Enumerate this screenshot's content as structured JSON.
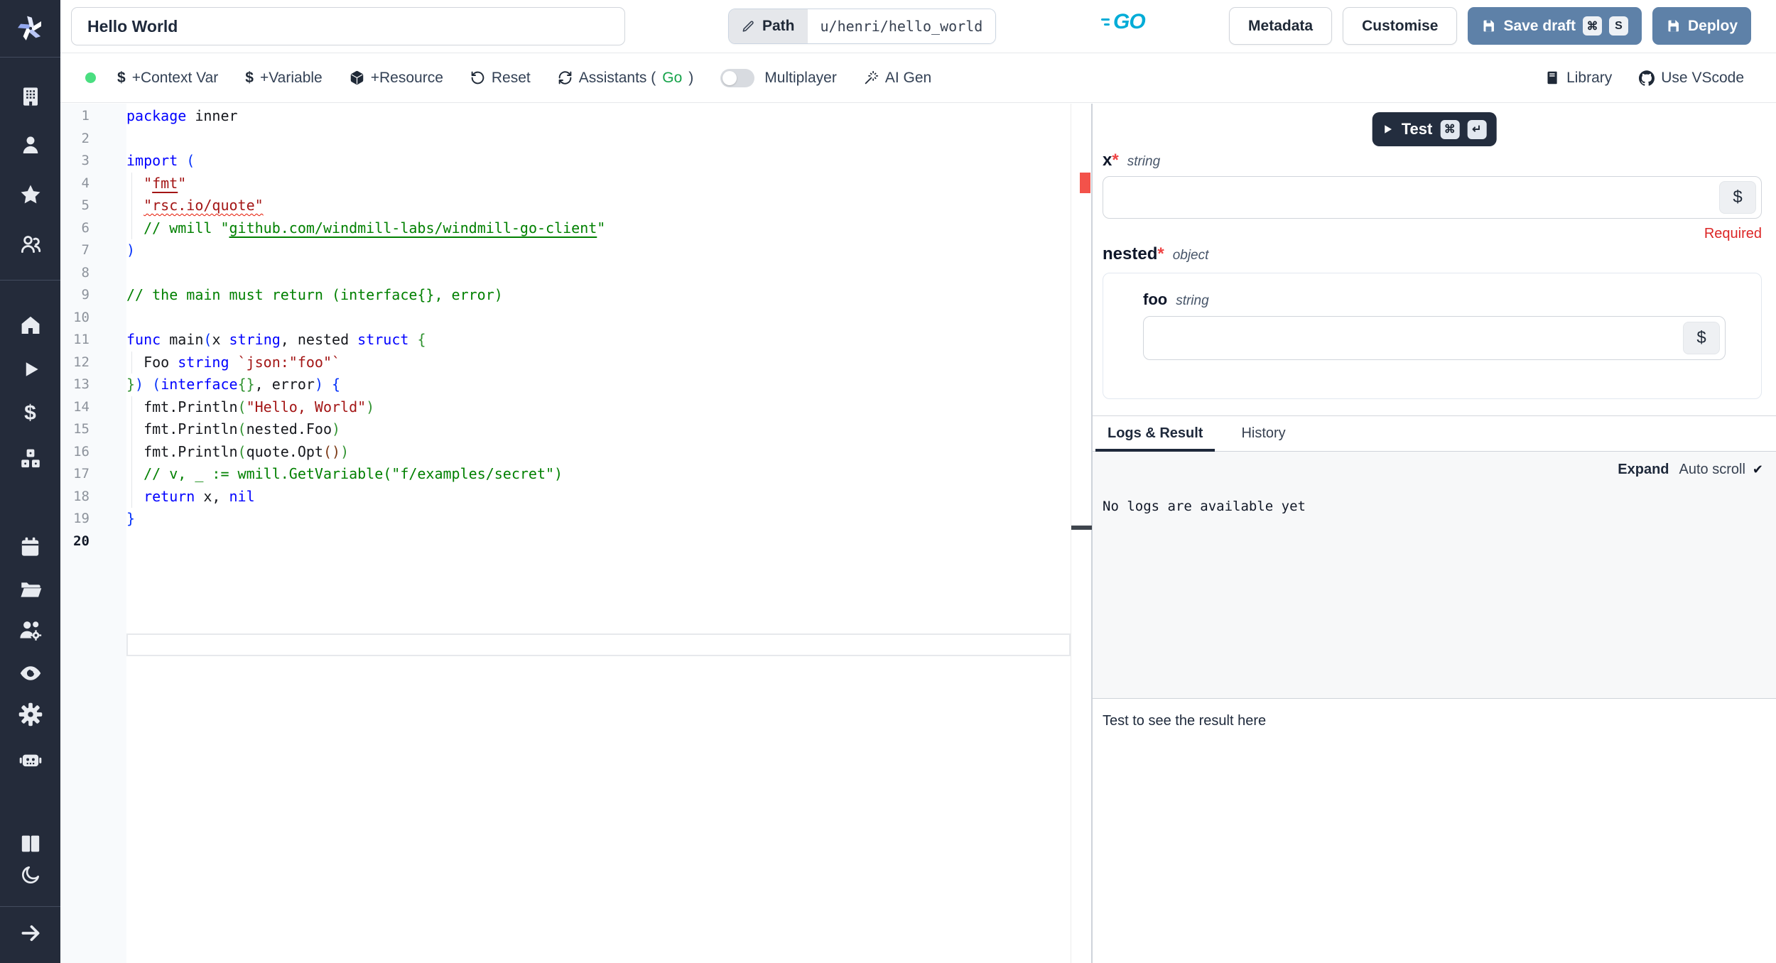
{
  "sidebar": {
    "icons": [
      "windmill-logo",
      "workspace-building",
      "user",
      "favorites-star",
      "groups",
      "home",
      "runs-play",
      "variables-dollar",
      "resources-cubes",
      "schedules-calendar",
      "folders",
      "workers-admin",
      "audit-eye",
      "settings-gear",
      "ai-robot",
      "docs-books",
      "dark-mode-moon",
      "expand-arrow"
    ]
  },
  "topbar": {
    "title": "Hello World",
    "path_label": "Path",
    "path_value": "u/henri/hello_world",
    "lang": "GO",
    "metadata": "Metadata",
    "customise": "Customise",
    "save_draft": "Save draft",
    "save_keys": [
      "⌘",
      "S"
    ],
    "deploy": "Deploy"
  },
  "toolbar": {
    "dollar": "$",
    "context_var": "+Context Var",
    "variable": "+Variable",
    "resource": "+Resource",
    "reset": "Reset",
    "assistants_pre": "Assistants (",
    "assistants_lang": "Go",
    "assistants_post": ")",
    "multiplayer": "Multiplayer",
    "ai_gen": "AI Gen",
    "library": "Library",
    "use_vscode": "Use VScode"
  },
  "editor": {
    "language": "go",
    "active_line": 20,
    "lines": [
      {
        "n": 1,
        "segs": [
          [
            "kw",
            "package"
          ],
          [
            "id",
            " inner"
          ]
        ]
      },
      {
        "n": 2,
        "segs": []
      },
      {
        "n": 3,
        "segs": [
          [
            "kw",
            "import"
          ],
          [
            "id",
            " "
          ],
          [
            "b1",
            "("
          ]
        ]
      },
      {
        "n": 4,
        "segs": [
          [
            "id",
            "  "
          ],
          [
            "str",
            "\""
          ],
          [
            "strlink",
            "fmt"
          ],
          [
            "str",
            "\""
          ]
        ]
      },
      {
        "n": 5,
        "segs": [
          [
            "id",
            "  "
          ],
          [
            "strerr",
            "\"rsc.io/quote\""
          ]
        ]
      },
      {
        "n": 6,
        "segs": [
          [
            "id",
            "  "
          ],
          [
            "com",
            "// wmill \""
          ],
          [
            "comlink",
            "github.com/windmill-labs/windmill-go-client"
          ],
          [
            "com",
            "\""
          ]
        ]
      },
      {
        "n": 7,
        "segs": [
          [
            "b1",
            ")"
          ]
        ]
      },
      {
        "n": 8,
        "segs": []
      },
      {
        "n": 9,
        "segs": [
          [
            "com",
            "// the main must return (interface{}, error)"
          ]
        ]
      },
      {
        "n": 10,
        "segs": []
      },
      {
        "n": 11,
        "segs": [
          [
            "kw",
            "func"
          ],
          [
            "id",
            " main"
          ],
          [
            "b1",
            "("
          ],
          [
            "id",
            "x "
          ],
          [
            "kw",
            "string"
          ],
          [
            "id",
            ", nested "
          ],
          [
            "kw",
            "struct"
          ],
          [
            "id",
            " "
          ],
          [
            "b2",
            "{"
          ]
        ]
      },
      {
        "n": 12,
        "segs": [
          [
            "id",
            "  Foo "
          ],
          [
            "kw",
            "string"
          ],
          [
            "id",
            " "
          ],
          [
            "str",
            "`json:\"foo\"`"
          ]
        ]
      },
      {
        "n": 13,
        "segs": [
          [
            "b2",
            "}"
          ],
          [
            "b1",
            ")"
          ],
          [
            "id",
            " "
          ],
          [
            "b1",
            "("
          ],
          [
            "kw",
            "interface"
          ],
          [
            "b2",
            "{}"
          ],
          [
            "id",
            ", error"
          ],
          [
            "b1",
            ")"
          ],
          [
            "id",
            " "
          ],
          [
            "b1",
            "{"
          ]
        ]
      },
      {
        "n": 14,
        "segs": [
          [
            "id",
            "  fmt.Println"
          ],
          [
            "b2",
            "("
          ],
          [
            "str",
            "\"Hello, World\""
          ],
          [
            "b2",
            ")"
          ]
        ]
      },
      {
        "n": 15,
        "segs": [
          [
            "id",
            "  fmt.Println"
          ],
          [
            "b2",
            "("
          ],
          [
            "id",
            "nested.Foo"
          ],
          [
            "b2",
            ")"
          ]
        ]
      },
      {
        "n": 16,
        "segs": [
          [
            "id",
            "  fmt.Println"
          ],
          [
            "b2",
            "("
          ],
          [
            "id",
            "quote.Opt"
          ],
          [
            "b3",
            "()"
          ],
          [
            "b2",
            ")"
          ]
        ]
      },
      {
        "n": 17,
        "segs": [
          [
            "com",
            "  // v, _ := wmill.GetVariable(\"f/examples/secret\")"
          ]
        ]
      },
      {
        "n": 18,
        "segs": [
          [
            "id",
            "  "
          ],
          [
            "kw",
            "return"
          ],
          [
            "id",
            " x, "
          ],
          [
            "kw",
            "nil"
          ]
        ]
      },
      {
        "n": 19,
        "segs": [
          [
            "b1",
            "}"
          ]
        ]
      },
      {
        "n": 20,
        "segs": []
      }
    ]
  },
  "run": {
    "test": "Test",
    "test_keys": [
      "⌘",
      "↵"
    ],
    "dollar": "$",
    "arg_x": {
      "name": "x",
      "star": "*",
      "type": "string",
      "value": "",
      "error": "Required"
    },
    "arg_nested": {
      "name": "nested",
      "star": "*",
      "type": "object"
    },
    "arg_foo": {
      "name": "foo",
      "type": "string",
      "value": ""
    }
  },
  "tabs": {
    "logs": "Logs & Result",
    "history": "History"
  },
  "logs": {
    "expand": "Expand",
    "autoscroll": "Auto scroll",
    "check": "✔",
    "empty": "No logs are available yet"
  },
  "result": {
    "placeholder": "Test to see the result here"
  }
}
